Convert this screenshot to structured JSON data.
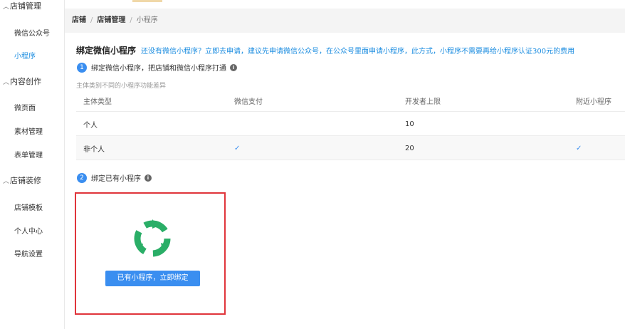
{
  "sidebar": {
    "groups": [
      {
        "label": "店铺管理"
      },
      {
        "label": "内容创作"
      },
      {
        "label": "店铺装修"
      }
    ],
    "items": [
      {
        "label": "微信公众号"
      },
      {
        "label": "小程序"
      },
      {
        "label": "微页面"
      },
      {
        "label": "素材管理"
      },
      {
        "label": "表单管理"
      },
      {
        "label": "店铺模板"
      },
      {
        "label": "个人中心"
      },
      {
        "label": "导航设置"
      }
    ]
  },
  "breadcrumb": [
    "店铺",
    "店铺管理",
    "小程序"
  ],
  "page": {
    "title": "绑定微信小程序",
    "hint": "还没有微信小程序？立即去申请，建议先申请微信公众号，在公众号里面申请小程序，此方式，小程序不需要再给小程序认证300元的费用",
    "step1": {
      "num": "1",
      "label": "绑定微信小程序，把店铺和微信小程序打通"
    },
    "note": "主体类别不同的小程序功能差异",
    "table": {
      "headers": [
        "主体类型",
        "微信支付",
        "开发者上限",
        "附近小程序"
      ],
      "rows": [
        [
          "个人",
          "",
          "10",
          ""
        ],
        [
          "非个人",
          "✓",
          "20",
          "✓"
        ]
      ]
    },
    "step2": {
      "num": "2",
      "label": "绑定已有小程序"
    },
    "bind_button": "已有小程序，立即绑定"
  },
  "colors": {
    "accent": "#3a8ef0",
    "link": "#1c8de0",
    "highlight_border": "#e0353b",
    "logo_green": "#2aae67"
  }
}
